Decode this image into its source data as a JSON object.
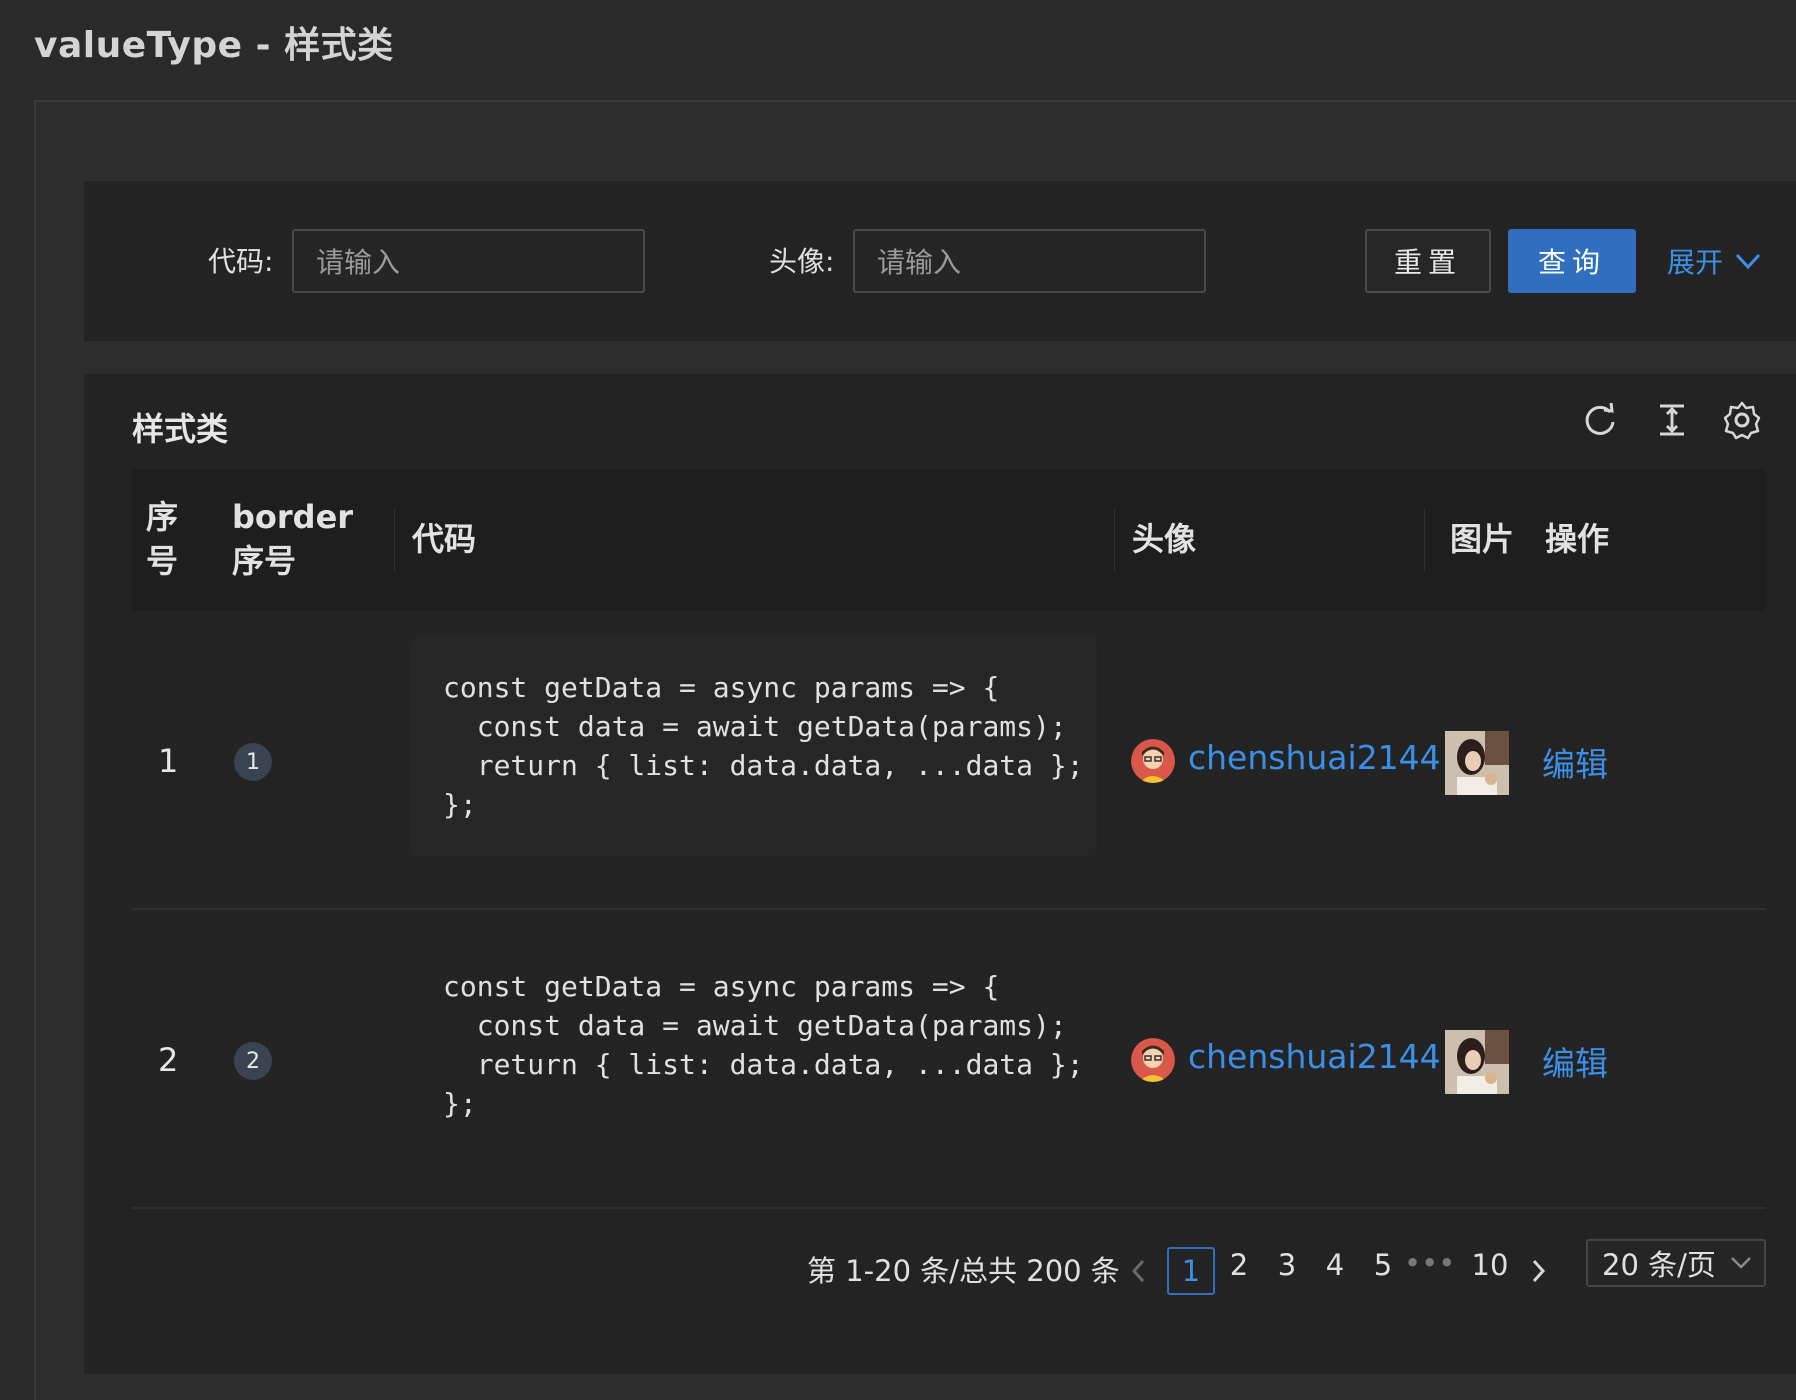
{
  "page": {
    "title": "valueType - 样式类"
  },
  "search": {
    "code_label": "代码:",
    "code_placeholder": "请输入",
    "avatar_label": "头像:",
    "avatar_placeholder": "请输入",
    "reset_label": "重置",
    "query_label": "查询",
    "expand_label": "展开"
  },
  "table": {
    "title": "样式类",
    "columns": [
      "序号",
      "border 序号",
      "代码",
      "头像",
      "图片",
      "操作"
    ],
    "rows": [
      {
        "index": "1",
        "border_index": "1",
        "code": [
          "const getData = async params => {",
          "  const data = await getData(params);",
          "  return { list: data.data, ...data };",
          "};"
        ],
        "user": "chenshuai2144",
        "action": "编辑"
      },
      {
        "index": "2",
        "border_index": "2",
        "code": [
          "const getData = async params => {",
          "  const data = await getData(params);",
          "  return { list: data.data, ...data };",
          "};"
        ],
        "user": "chenshuai2144",
        "action": "编辑"
      }
    ]
  },
  "pagination": {
    "total_text": "第 1-20 条/总共 200 条",
    "pages": [
      "1",
      "2",
      "3",
      "4",
      "5",
      "•••",
      "10"
    ],
    "current": "1",
    "page_size": "20 条/页"
  },
  "colors": {
    "accent": "#3b8fe6",
    "primary_button": "#2f6fbd",
    "background": "#2a2a2a"
  },
  "icons": [
    "reload-icon",
    "column-height-icon",
    "setting-icon",
    "chevron-down-icon",
    "left-icon",
    "right-icon"
  ]
}
